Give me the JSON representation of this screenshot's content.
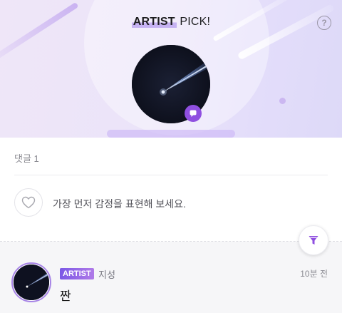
{
  "header": {
    "title_highlight": "ARTIST",
    "title_rest": " PICK!",
    "help_icon_glyph": "?"
  },
  "comments": {
    "count_label": "댓글 1",
    "empty_prompt": "가장 먼저 감정을 표현해 보세요.",
    "items": [
      {
        "badge": "ARTIST",
        "author": "지성",
        "time": "10분 전",
        "text": "짠"
      }
    ]
  },
  "icons": {
    "help": "help-circle-icon",
    "chat": "chat-bubble-icon",
    "heart": "heart-outline-icon",
    "filter": "funnel-filter-icon"
  },
  "colors": {
    "accent": "#8f4fe0",
    "badge_gradient_start": "#7b58e6",
    "badge_gradient_end": "#b07ae8",
    "title_highlight": "#c6b3f2"
  }
}
